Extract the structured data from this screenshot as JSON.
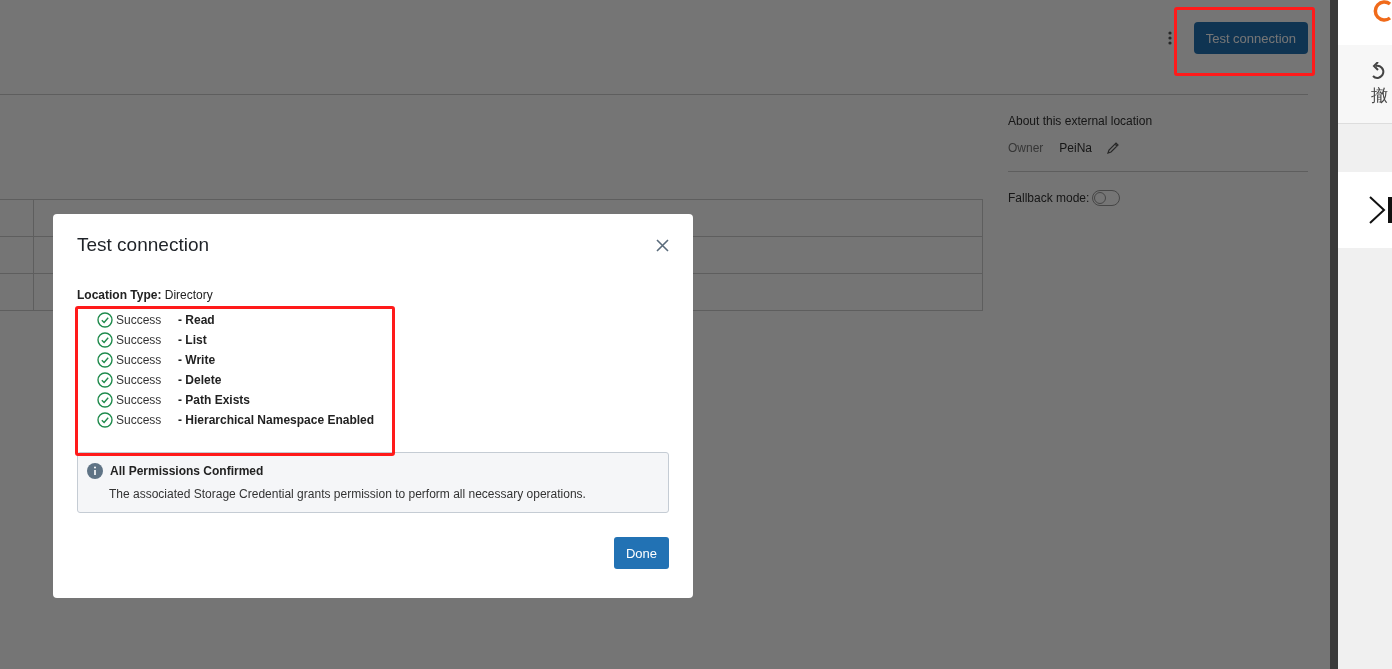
{
  "header": {
    "button": "Test connection"
  },
  "about": {
    "title": "About this external location",
    "owner_label": "Owner",
    "owner": "PeiNa"
  },
  "fallback_mode": {
    "label": "Fallback mode:",
    "on": false
  },
  "dialog": {
    "title": "Test connection",
    "location_label": "Location Type:",
    "location_value": "Directory",
    "results": [
      {
        "status": "Success",
        "check": "- Read"
      },
      {
        "status": "Success",
        "check": "- List"
      },
      {
        "status": "Success",
        "check": "- Write"
      },
      {
        "status": "Success",
        "check": "- Delete"
      },
      {
        "status": "Success",
        "check": "- Path Exists"
      },
      {
        "status": "Success",
        "check": "- Hierarchical Namespace Enabled"
      }
    ],
    "notice": {
      "title": "All Permissions Confirmed",
      "text": "The associated Storage Credential grants permission to perform all necessary operations."
    },
    "button": "Done"
  },
  "side_strip": {
    "label": "撤"
  }
}
